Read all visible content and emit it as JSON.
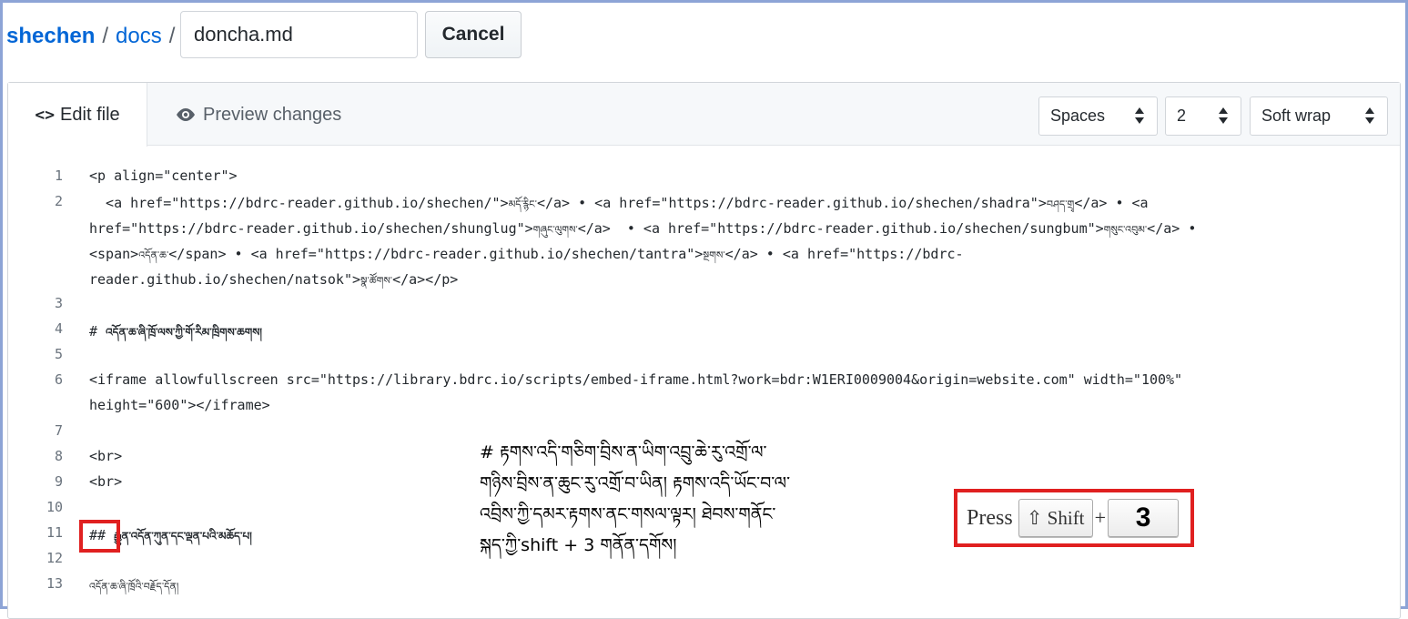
{
  "breadcrumb": {
    "repo": "shechen",
    "sep1": "/",
    "folder": "docs",
    "sep2": "/"
  },
  "filename_input": {
    "value": "doncha.md"
  },
  "cancel_label": "Cancel",
  "tabs": {
    "edit_label": "Edit file",
    "edit_icon": "<>",
    "preview_label": "Preview changes"
  },
  "options": {
    "indent_mode": "Spaces",
    "indent_size": "2",
    "wrap_mode": "Soft wrap"
  },
  "lines": [
    {
      "n": "1",
      "text": "<p align=\"center\">"
    },
    {
      "n": "2",
      "parts": [
        "  <a href=\"https://bdrc-reader.github.io/shechen/\">",
        "མདོ་རྙིང་",
        "</a> • <a href=\"https://bdrc-reader.github.io/shechen/shadra\">",
        "བཤད་གྲྭ",
        "</a> • <a",
        "href=\"https://bdrc-reader.github.io/shechen/shunglug\">",
        "གཞུང་ལུགས་",
        "</a>  • <a href=\"https://bdrc-reader.github.io/shechen/sungbum\">",
        "གསུང་འབུམ་",
        "</a> •",
        "<span>",
        "འདོན་ཆ་",
        "</span> • <a href=\"https://bdrc-reader.github.io/shechen/tantra\">",
        "སྔགས་",
        "</a> • <a href=\"https://bdrc-",
        "reader.github.io/shechen/natsok\">",
        "སྣ་ཚོགས་",
        "</a></p>"
      ]
    },
    {
      "n": "3",
      "text": ""
    },
    {
      "n": "4",
      "hash": "# ",
      "tib": "འདོན་ཆ་ཞི་ཁྲོ་ལས་ཀྱི་གོ་རིམ་ཁྲིགས་ཆགས།"
    },
    {
      "n": "5",
      "text": ""
    },
    {
      "n": "6",
      "text": "<iframe allowfullscreen src=\"https://library.bdrc.io/scripts/embed-iframe.html?work=bdr:W1ERI0009004&origin=website.com\" width=\"100%\"",
      "text2": "height=\"600\"></iframe>"
    },
    {
      "n": "7",
      "text": ""
    },
    {
      "n": "8",
      "text": "<br>"
    },
    {
      "n": "9",
      "text": "<br>"
    },
    {
      "n": "10",
      "text": ""
    },
    {
      "n": "11",
      "hash": "##",
      "tib": "རྒྱུན་འདོན་ཀུན་དང་ལྡན་པའི་མཆོད་པ།"
    },
    {
      "n": "12",
      "text": ""
    },
    {
      "n": "13",
      "tib": "འདོན་ཆ་ཞི་ཁྲོའི་བརྗོད་དོན།"
    }
  ],
  "annotation": {
    "line1": "# རྟགས་འདི་གཅིག་བྲིས་ན་ཡིག་འབྲུ་ཆེ་རུ་འགྲོ་ལ་",
    "line2": "གཉིས་བྲིས་ན་ཆུང་རུ་འགྲོ་བ་ཡིན། རྟགས་འདི་ཡོང་བ་ལ་",
    "line3": "འབྲིས་ཀྱི་དམར་རྟགས་ནང་གསལ་ལྟར། ཐེབས་གནོང་",
    "line4": "སྐད་ཀྱི་shift + 3 གནོན་དགོས།"
  },
  "press_hint": {
    "label": "Press",
    "shift_key": "⇧ Shift",
    "plus": "+",
    "digit_key": "3"
  },
  "colors": {
    "link": "#0366d6",
    "highlight": "#e02020",
    "frame": "#8da4d6"
  }
}
